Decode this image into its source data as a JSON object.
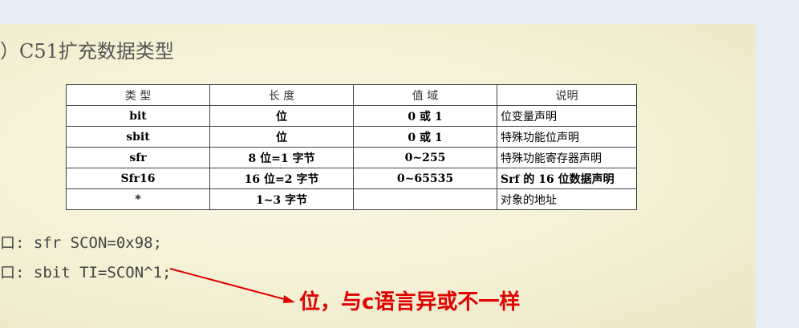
{
  "slide": {
    "title": "）C51扩充数据类型",
    "table": {
      "headers": [
        "类 型",
        "长 度",
        "值 域",
        "说明"
      ],
      "rows": [
        {
          "type": "bit",
          "length": "位",
          "range": "0 或 1",
          "desc": "位变量声明"
        },
        {
          "type": "sbit",
          "length": "位",
          "range": "0 或 1",
          "desc": "特殊功能位声明"
        },
        {
          "type": "sfr",
          "length": "8 位=1 字节",
          "range": "0~255",
          "desc": "特殊功能寄存器声明"
        },
        {
          "type": "Sfr16",
          "length": "16 位=2 字节",
          "range": "0~65535",
          "desc": "Srf 的 16 位数据声明"
        },
        {
          "type": "*",
          "length": "1~3 字节",
          "range": "",
          "desc": "对象的地址"
        }
      ]
    },
    "code_lines": [
      "口: sfr SCON=0x98;",
      "口: sbit TI=SCON^1;"
    ],
    "annotation": "位，与c语言异或不一样",
    "annotation_color": "#e00000"
  }
}
